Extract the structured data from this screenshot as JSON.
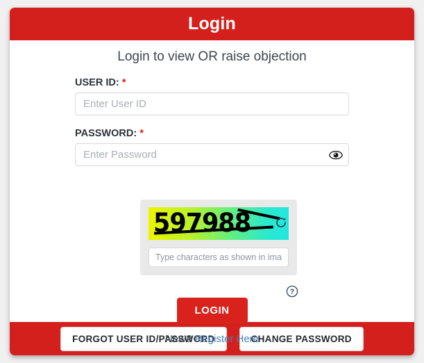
{
  "header": {
    "title": "Login",
    "bg_color": "#d4201c"
  },
  "body": {
    "subtitle": "Login to view OR raise objection",
    "user_id": {
      "label": "USER ID:",
      "required_marker": "*",
      "placeholder": "Enter User ID",
      "value": ""
    },
    "password": {
      "label": "PASSWORD:",
      "required_marker": "*",
      "placeholder": "Enter Password",
      "value": "",
      "toggle_icon": "eye-icon"
    },
    "captcha": {
      "code": "597988",
      "refresh_icon": "refresh-icon",
      "help_icon": "question-mark-icon",
      "input_placeholder": "Type characters as shown in image",
      "input_value": "",
      "gradient_start": "#ecf400",
      "gradient_end": "#21e7e0"
    },
    "login_button": "LOGIN",
    "register_prompt": "New?",
    "register_link": "Register Here",
    "link_color": "#4a7fb5"
  },
  "footer": {
    "forgot_button": "FORGOT USER ID/PASSWORD",
    "change_password_button": "CHANGE PASSWORD",
    "bg_color": "#d4201c"
  }
}
